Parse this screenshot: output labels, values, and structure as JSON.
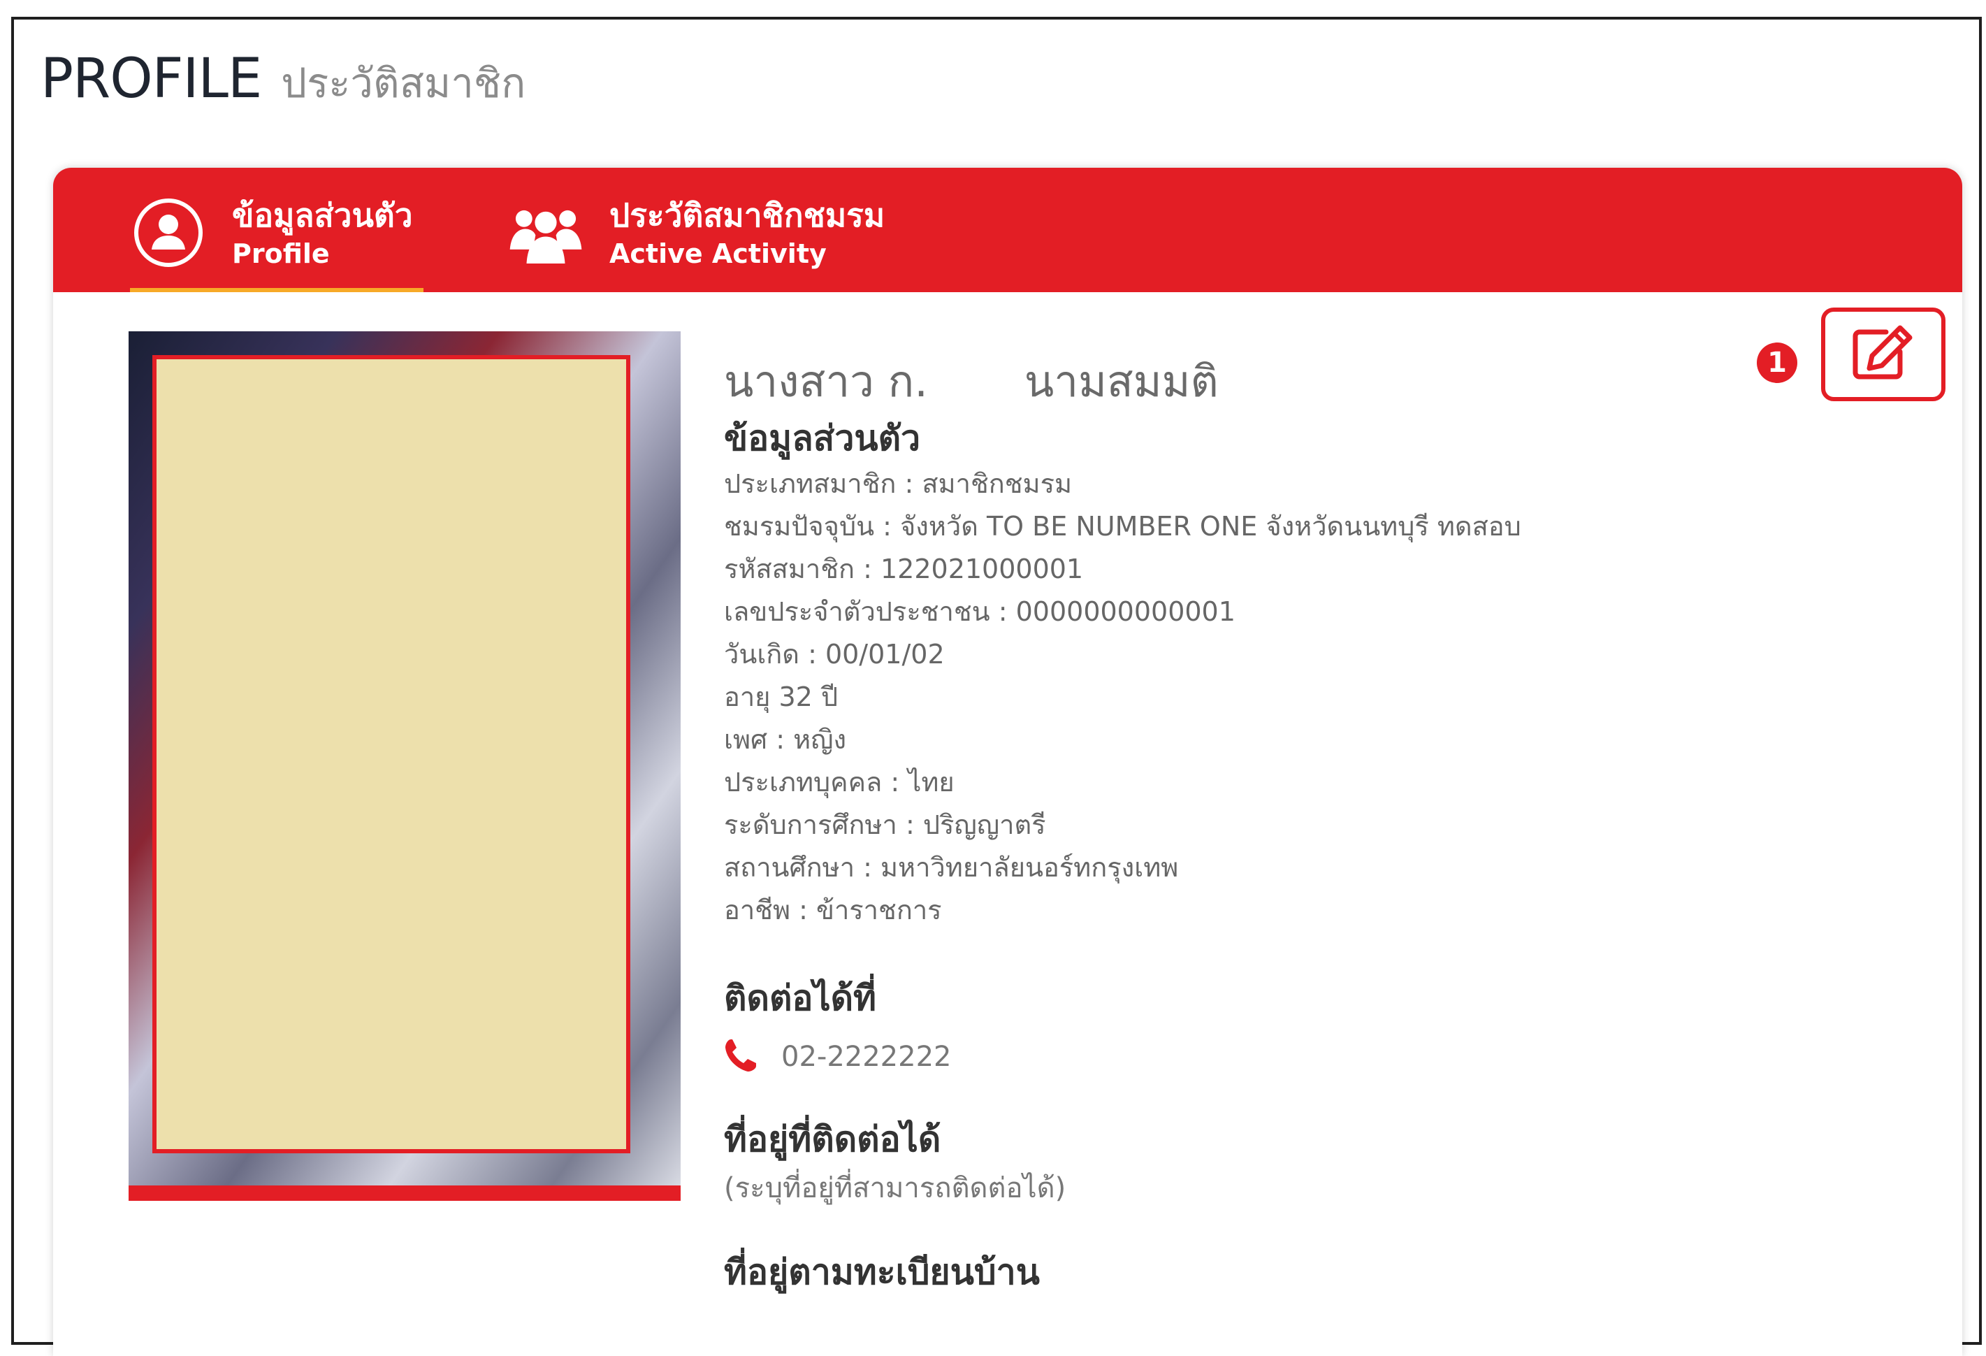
{
  "page": {
    "title": "PROFILE",
    "subtitle": "ประวัติสมาชิก"
  },
  "tabs": [
    {
      "title": "ข้อมูลส่วนตัว",
      "subtitle": "Profile",
      "icon": "user-circle-icon",
      "active": true
    },
    {
      "title": "ประวัติสมาชิกชมรม",
      "subtitle": "Active Activity",
      "icon": "users-group-icon",
      "active": false
    }
  ],
  "profile": {
    "name": "นางสาว ก.       นามสมมติ",
    "personal_heading": "ข้อมูลส่วนตัว",
    "fields": [
      {
        "text": "ประเภทสมาชิก : สมาชิกชมรม"
      },
      {
        "text": "ชมรมปัจจุบัน : จังหวัด TO BE NUMBER ONE จังหวัดนนทบุรี ทดสอบ"
      },
      {
        "text": "รหัสสมาชิก : 122021000001"
      },
      {
        "text": "เลขประจำตัวประชาชน : 0000000000001"
      },
      {
        "text": "วันเกิด : 00/01/02"
      },
      {
        "text": "อายุ  32 ปี"
      },
      {
        "text": "เพศ : หญิง"
      },
      {
        "text": "ประเภทบุคคล : ไทย"
      },
      {
        "text": "ระดับการศึกษา : ปริญญาตรี"
      },
      {
        "text": "สถานศึกษา : มหาวิทยาลัยนอร์ทกรุงเทพ"
      },
      {
        "text": "อาชีพ : ข้าราชการ"
      }
    ],
    "contact_heading": "ติดต่อได้ที่",
    "phone": "02-2222222",
    "address_heading": "ที่อยู่ที่ติดต่อได้",
    "address_note": "(ระบุที่อยู่ที่สามารถติดต่อได้)",
    "registered_address_heading": "ที่อยู่ตามทะเบียนบ้าน"
  },
  "edit": {
    "marker": "1",
    "icon": "edit-icon"
  },
  "colors": {
    "brand_red": "#e31e25",
    "tab_underline": "#f7a928",
    "redaction_fill": "#ede0ac"
  }
}
